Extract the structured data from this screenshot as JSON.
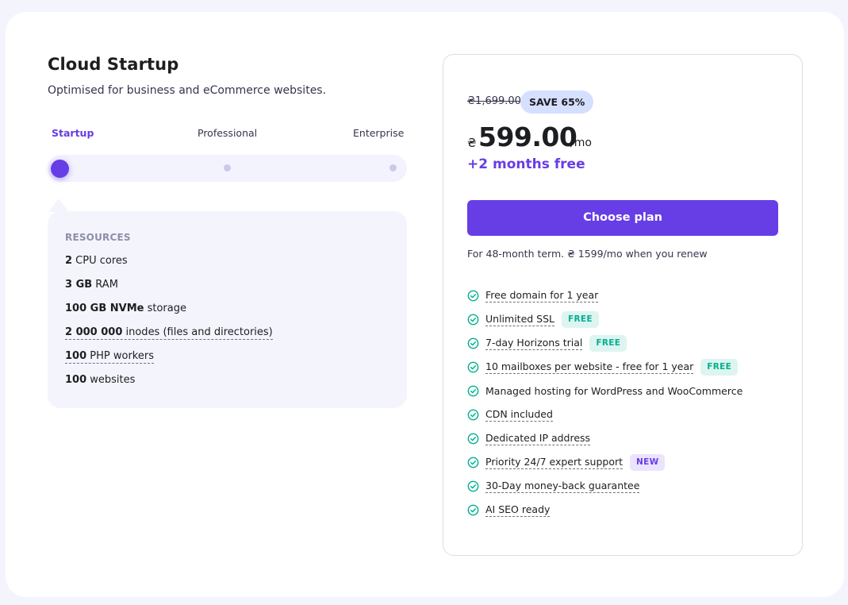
{
  "plan": {
    "title": "Cloud Startup",
    "subtitle": "Optimised for business and eCommerce websites."
  },
  "tiers": [
    {
      "label": "Startup",
      "active": true
    },
    {
      "label": "Professional",
      "active": false
    },
    {
      "label": "Enterprise",
      "active": false
    }
  ],
  "resources": {
    "heading": "RESOURCES",
    "items": [
      {
        "bold": "2",
        "rest": " CPU cores"
      },
      {
        "bold": "3 GB",
        "rest": " RAM"
      },
      {
        "bold": "100 GB NVMe",
        "rest": " storage"
      },
      {
        "bold": "2 000 000",
        "rest": " inodes (files and directories)"
      },
      {
        "bold": "100",
        "rest": " PHP workers"
      },
      {
        "bold": "100",
        "rest": " websites"
      }
    ]
  },
  "pricing": {
    "old_price": "₴1,699.00",
    "save_badge": "SAVE 65%",
    "currency": "₴",
    "price": "599.00",
    "period": "/mo",
    "bonus": "+2 months free",
    "cta": "Choose plan",
    "renew_note": "For 48-month term. ₴ 1599/mo when you renew"
  },
  "features": [
    {
      "text": "Free domain for 1 year",
      "tag": ""
    },
    {
      "text": "Unlimited SSL",
      "tag": "FREE"
    },
    {
      "text": "7-day Horizons trial",
      "tag": "FREE"
    },
    {
      "text": "10 mailboxes per website - free for 1 year",
      "tag": "FREE"
    },
    {
      "text": "Managed hosting for WordPress and WooCommerce",
      "tag": ""
    },
    {
      "text": "CDN included",
      "tag": ""
    },
    {
      "text": "Dedicated IP address",
      "tag": ""
    },
    {
      "text": "Priority 24/7 expert support",
      "tag": "NEW"
    },
    {
      "text": "30-Day money-back guarantee",
      "tag": ""
    },
    {
      "text": "AI SEO ready",
      "tag": ""
    }
  ],
  "colors": {
    "accent": "#673de6",
    "check": "#00b090",
    "save_badge_bg": "#d5dfff"
  }
}
